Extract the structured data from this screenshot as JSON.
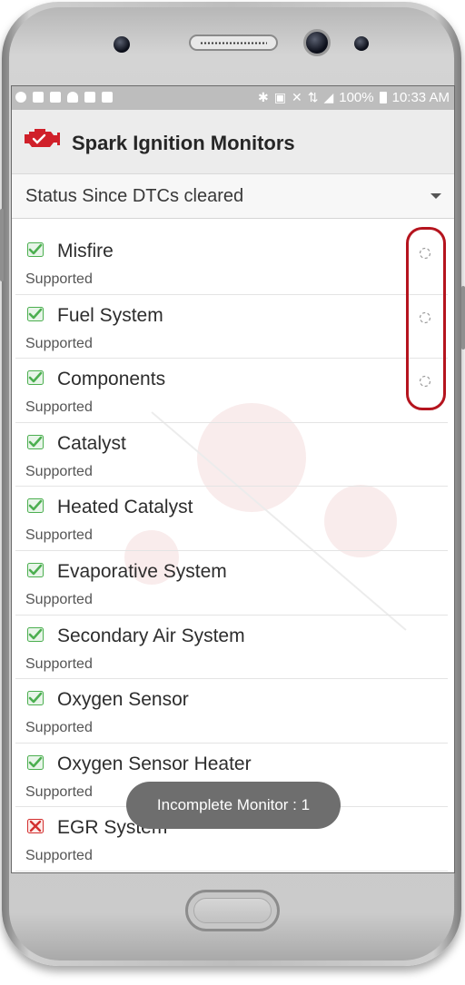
{
  "statusbar": {
    "battery": "100%",
    "time": "10:33 AM"
  },
  "appbar": {
    "title": "Spark Ignition Monitors",
    "logo_icon": "engine-check-icon",
    "brand_color": "#d0202a"
  },
  "status_select": {
    "value": "Status Since DTCs cleared"
  },
  "monitors": [
    {
      "name": "Misfire",
      "status": "Supported",
      "check": "green-check",
      "pending": true
    },
    {
      "name": "Fuel System",
      "status": "Supported",
      "check": "green-check",
      "pending": true
    },
    {
      "name": "Components",
      "status": "Supported",
      "check": "green-check",
      "pending": true
    },
    {
      "name": "Catalyst",
      "status": "Supported",
      "check": "green-check",
      "pending": false
    },
    {
      "name": "Heated Catalyst",
      "status": "Supported",
      "check": "green-check",
      "pending": false
    },
    {
      "name": "Evaporative System",
      "status": "Supported",
      "check": "green-check",
      "pending": false
    },
    {
      "name": "Secondary Air System",
      "status": "Supported",
      "check": "green-check",
      "pending": false
    },
    {
      "name": "Oxygen Sensor",
      "status": "Supported",
      "check": "green-check",
      "pending": false
    },
    {
      "name": "Oxygen Sensor Heater",
      "status": "Supported",
      "check": "green-check",
      "pending": false
    },
    {
      "name": "EGR System",
      "status": "Supported",
      "check": "red-x",
      "pending": false
    }
  ],
  "toast": {
    "text": "Incomplete Monitor : 1"
  },
  "colors": {
    "check_green": "#4caf50",
    "fail_red": "#d32f2f",
    "highlight_red": "#b5141e"
  }
}
